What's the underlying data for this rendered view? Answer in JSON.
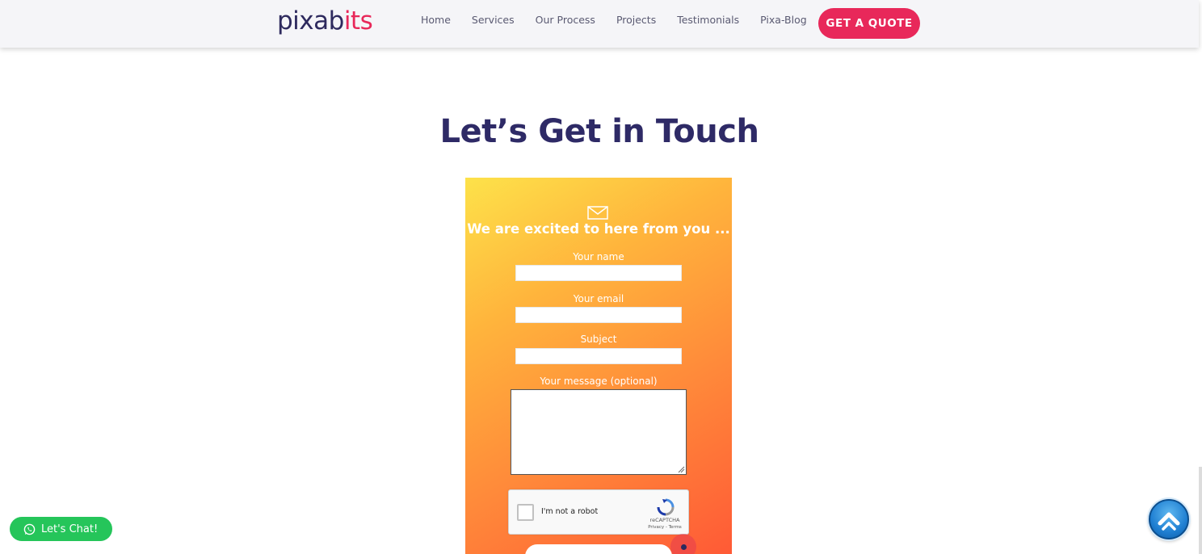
{
  "header": {
    "logo": {
      "part_a": "pixab",
      "part_b": "its"
    },
    "nav": [
      {
        "label": "Home"
      },
      {
        "label": "Services"
      },
      {
        "label": "Our Process"
      },
      {
        "label": "Projects"
      },
      {
        "label": "Testimonials"
      },
      {
        "label": "Pixa-Blog"
      }
    ],
    "cta_label": "GET A QUOTE"
  },
  "page_title": "Let’s Get in Touch",
  "form": {
    "icon": "envelope-icon",
    "title": "We are excited to here from you ...",
    "fields": {
      "name_label": "Your name",
      "email_label": "Your email",
      "subject_label": "Subject",
      "message_label": "Your message (optional)"
    },
    "recaptcha": {
      "label": "I'm not a robot",
      "brand": "reCAPTCHA",
      "links": "Privacy - Terms"
    }
  },
  "widgets": {
    "chat_label": "Let's Chat!",
    "chat_icon": "whatsapp-icon",
    "scroll_icon": "chevron-up-icon"
  },
  "colors": {
    "brand_dark": "#2e2a5e",
    "brand_pink": "#e8285a",
    "chat_green": "#25c55a",
    "card_gradient_start": "#fde24a",
    "card_gradient_end": "#ff5a36"
  }
}
